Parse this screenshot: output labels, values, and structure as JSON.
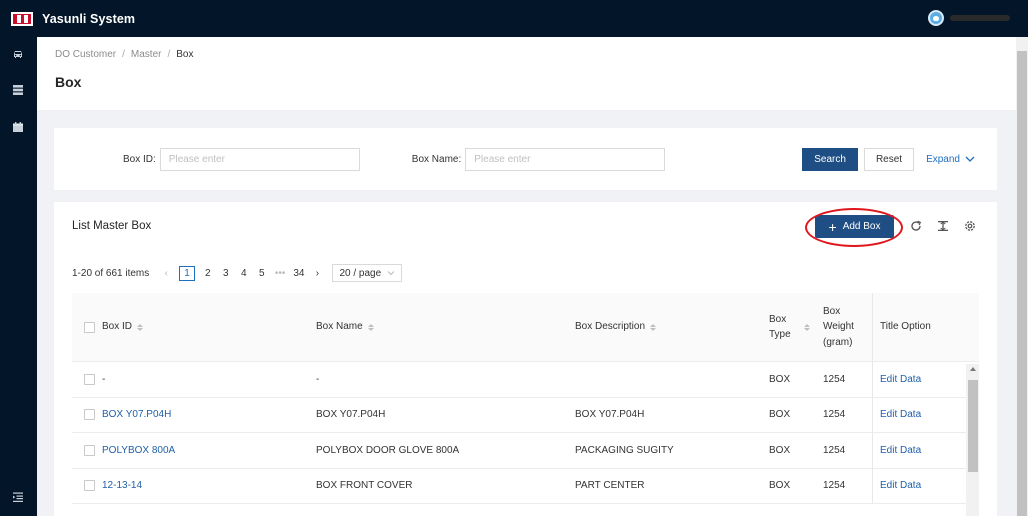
{
  "app": {
    "title": "Yasunli System"
  },
  "breadcrumb": [
    "DO Customer",
    "Master",
    "Box"
  ],
  "page": {
    "title": "Box"
  },
  "sidebar": {
    "icons": [
      "car-icon",
      "list-icon",
      "calendar-icon"
    ],
    "collapse_icon": "menu-collapse-icon"
  },
  "filters": {
    "box_id": {
      "label": "Box ID",
      "placeholder": "Please enter",
      "value": ""
    },
    "box_name": {
      "label": "Box Name",
      "placeholder": "Please enter",
      "value": ""
    },
    "search_label": "Search",
    "reset_label": "Reset",
    "expand_label": "Expand"
  },
  "list": {
    "title": "List Master Box",
    "add_label": "Add Box",
    "highlight_color": "#e0161d",
    "toolbar_icons": [
      "reload-icon",
      "column-height-icon",
      "settings-icon"
    ]
  },
  "pagination": {
    "summary": "1-20 of 661 items",
    "pages": [
      "1",
      "2",
      "3",
      "4",
      "5"
    ],
    "ellipsis": "•••",
    "last": "34",
    "current": "1",
    "page_size": "20 / page"
  },
  "table": {
    "columns": {
      "box_id": "Box ID",
      "box_name": "Box Name",
      "box_description": "Box Description",
      "box_type": "Box Type",
      "box_weight": "Box Weight (gram)",
      "title_option": "Title Option"
    },
    "rows": [
      {
        "box_id": "-",
        "box_name": "-",
        "box_description": "",
        "box_type": "BOX",
        "box_weight": "1254",
        "action": "Edit Data"
      },
      {
        "box_id": "BOX Y07.P04H",
        "box_name": "BOX Y07.P04H",
        "box_description": "BOX Y07.P04H",
        "box_type": "BOX",
        "box_weight": "1254",
        "action": "Edit Data"
      },
      {
        "box_id": "POLYBOX 800A",
        "box_name": "POLYBOX DOOR GLOVE 800A",
        "box_description": "PACKAGING SUGITY",
        "box_type": "BOX",
        "box_weight": "1254",
        "action": "Edit Data"
      },
      {
        "box_id": "12-13-14",
        "box_name": "BOX FRONT COVER",
        "box_description": "PART CENTER",
        "box_type": "BOX",
        "box_weight": "1254",
        "action": "Edit Data"
      }
    ]
  },
  "colors": {
    "primary": "#1f4e85",
    "nav": "#021529",
    "link": "#1f5fa8"
  }
}
